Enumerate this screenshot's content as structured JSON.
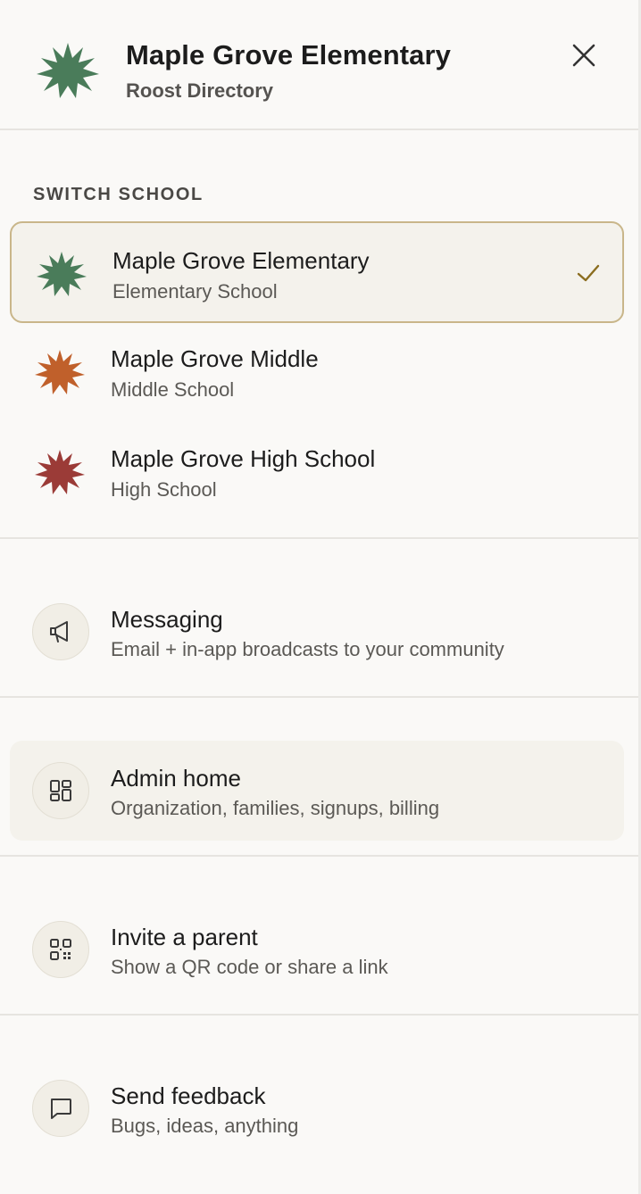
{
  "header": {
    "title": "Maple Grove Elementary",
    "subtitle": "Roost Directory",
    "logo_icon": "starburst-icon",
    "logo_color": "#4a7c5a",
    "close_icon": "close-icon"
  },
  "switch_school": {
    "label": "SWITCH SCHOOL",
    "schools": [
      {
        "name": "Maple Grove Elementary",
        "type": "Elementary School",
        "color": "#4a7c5a",
        "selected": true
      },
      {
        "name": "Maple Grove Middle",
        "type": "Middle School",
        "color": "#c0602b",
        "selected": false
      },
      {
        "name": "Maple Grove High School",
        "type": "High School",
        "color": "#9b3b37",
        "selected": false
      }
    ],
    "check_icon": "check-icon",
    "check_color": "#8a6d1f"
  },
  "menu": [
    {
      "title": "Messaging",
      "description": "Email + in-app broadcasts to your community",
      "icon": "megaphone-icon",
      "active": false
    },
    {
      "title": "Admin home",
      "description": "Organization, families, signups, billing",
      "icon": "dashboard-icon",
      "active": true
    },
    {
      "title": "Invite a parent",
      "description": "Show a QR code or share a link",
      "icon": "qr-code-icon",
      "active": false
    },
    {
      "title": "Send feedback",
      "description": "Bugs, ideas, anything",
      "icon": "chat-bubble-icon",
      "active": false
    }
  ],
  "colors": {
    "background": "#faf9f7",
    "selected_bg": "#f4f2ec",
    "selected_border": "#c9b68a",
    "divider": "#e6e4e0"
  }
}
